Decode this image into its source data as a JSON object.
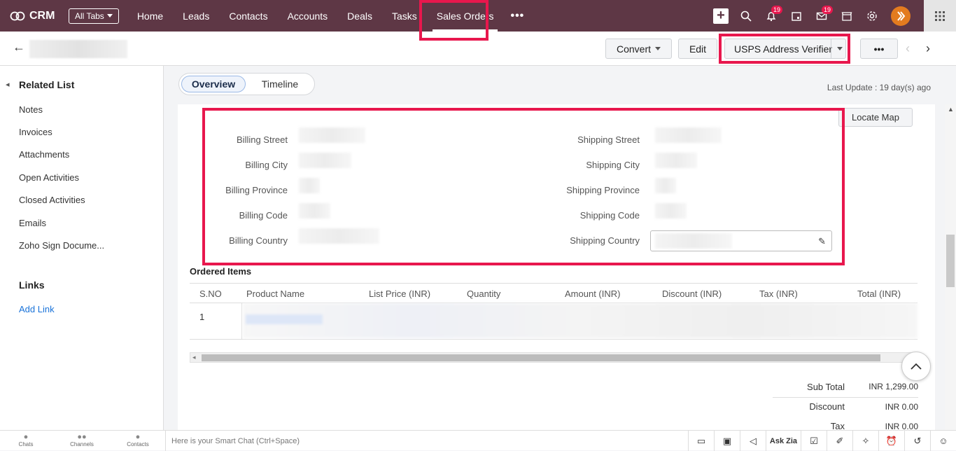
{
  "app": {
    "name": "CRM"
  },
  "topnav": {
    "all_tabs": "All Tabs",
    "tabs": [
      "Home",
      "Leads",
      "Contacts",
      "Accounts",
      "Deals",
      "Tasks",
      "Sales Orders"
    ],
    "more": "•••",
    "active_tab": "Sales Orders",
    "notif_badge": "19",
    "mail_badge": "19"
  },
  "toolbar": {
    "convert": "Convert",
    "edit": "Edit",
    "usps": "USPS Address Verifier",
    "more": "•••"
  },
  "sidebar": {
    "title": "Related List",
    "items": [
      "Notes",
      "Invoices",
      "Attachments",
      "Open Activities",
      "Closed Activities",
      "Emails",
      "Zoho Sign Docume..."
    ],
    "links_title": "Links",
    "add_link": "Add Link"
  },
  "view_toggle": {
    "overview": "Overview",
    "timeline": "Timeline"
  },
  "last_update": "Last Update : 19 day(s) ago",
  "address": {
    "locate_map": "Locate Map",
    "billing_labels": [
      "Billing Street",
      "Billing City",
      "Billing Province",
      "Billing Code",
      "Billing Country"
    ],
    "shipping_labels": [
      "Shipping Street",
      "Shipping City",
      "Shipping Province",
      "Shipping Code",
      "Shipping Country"
    ]
  },
  "ordered_items": {
    "title": "Ordered Items",
    "columns": [
      "S.NO",
      "Product Name",
      "List Price (INR)",
      "Quantity",
      "Amount (INR)",
      "Discount (INR)",
      "Tax (INR)",
      "Total (INR)"
    ],
    "rows": [
      {
        "sno": "1"
      }
    ]
  },
  "totals": {
    "sub_total_label": "Sub Total",
    "sub_total": "INR 1,299.00",
    "discount_label": "Discount",
    "discount": "INR 0.00",
    "tax_label": "Tax",
    "tax": "INR 0.00"
  },
  "bottombar": {
    "chats": "Chats",
    "channels": "Channels",
    "contacts": "Contacts",
    "smart_chat": "Here is your Smart Chat (Ctrl+Space)",
    "ask_zia": "Ask Zia"
  },
  "colors": {
    "topbar": "#5e3745",
    "highlight": "#e8174d",
    "link": "#1a73d9"
  }
}
